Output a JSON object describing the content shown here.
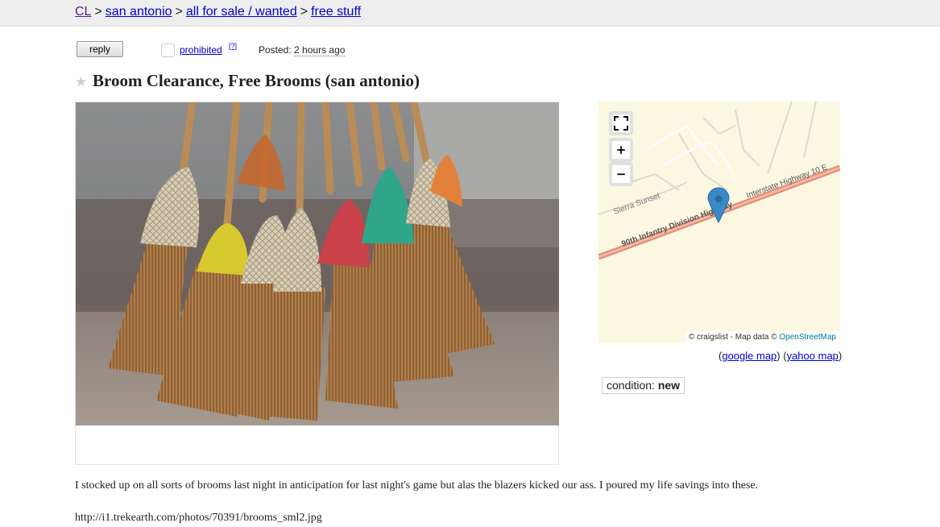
{
  "breadcrumb": {
    "items": [
      "CL",
      "san antonio",
      "all for sale / wanted",
      "free stuff"
    ],
    "separator": ">"
  },
  "toolbar": {
    "reply_label": "reply",
    "prohibited_label": "prohibited",
    "help_label": "[?]",
    "posted_label": "Posted:",
    "posted_value": "2 hours ago"
  },
  "posting": {
    "title": "Broom Clearance, Free Brooms (san antonio)",
    "body": "I stocked up on all sorts of brooms last night in anticipation for last night's game but alas the blazers kicked our ass. I poured my life savings into these.",
    "url": "http://i1.trekearth.com/photos/70391/brooms_sml2.jpg"
  },
  "map": {
    "road_labels": [
      "90th Infantry Division Highway",
      "Interstate Highway 10 E",
      "Sierra Sunset"
    ],
    "attribution_prefix": "© craigslist - Map data ©",
    "attribution_link": "OpenStreetMap",
    "google_map_label": "google map",
    "yahoo_map_label": "yahoo map",
    "controls": {
      "fullscreen": "fullscreen-icon",
      "zoom_in": "+",
      "zoom_out": "−"
    }
  },
  "attributes": {
    "condition_label": "condition:",
    "condition_value": "new"
  },
  "colors": {
    "link": "#0000cc",
    "visited": "#551a8b",
    "map_bg": "#fbf7e1",
    "road": "#e08a74",
    "pin": "#3b89c9"
  }
}
